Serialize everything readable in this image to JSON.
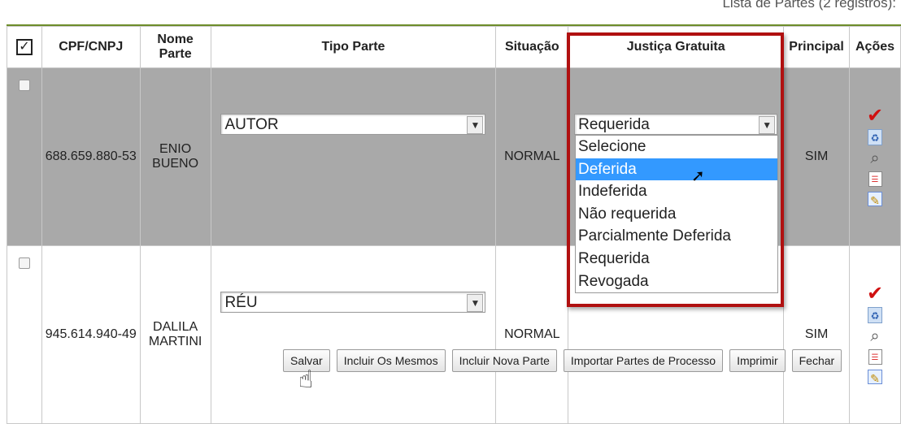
{
  "caption": "Lista de Partes (2 registros):",
  "headers": {
    "check": "✓",
    "cpf": "CPF/CNPJ",
    "nome": "Nome Parte",
    "tipo": "Tipo Parte",
    "situacao": "Situação",
    "justica": "Justiça Gratuita",
    "principal": "Principal",
    "acoes": "Ações"
  },
  "rows": [
    {
      "cpf": "688.659.880-53",
      "nome": "ENIO BUENO",
      "tipo": "AUTOR",
      "situacao": "NORMAL",
      "justica": "Requerida",
      "principal": "SIM"
    },
    {
      "cpf": "945.614.940-49",
      "nome": "DALILA MARTINI",
      "tipo": "RÉU",
      "situacao": "NORMAL",
      "justica": "",
      "principal": "SIM"
    }
  ],
  "dropdown": {
    "options": [
      "Selecione",
      "Deferida",
      "Indeferida",
      "Não requerida",
      "Parcialmente Deferida",
      "Requerida",
      "Revogada"
    ],
    "highlighted": "Deferida"
  },
  "buttons": {
    "salvar": "Salvar",
    "incluir_mesmos": "Incluir Os Mesmos",
    "incluir_nova": "Incluir Nova Parte",
    "importar": "Importar Partes de Processo",
    "imprimir": "Imprimir",
    "fechar": "Fechar"
  },
  "icons": {
    "confirm": "check-icon",
    "delete": "recycle-icon",
    "view": "search-icon",
    "list": "list-icon",
    "edit": "edit-icon"
  },
  "colors": {
    "selected_row": "#a9a9a9",
    "highlight": "#3399ff",
    "annotation_box": "#b01010"
  }
}
